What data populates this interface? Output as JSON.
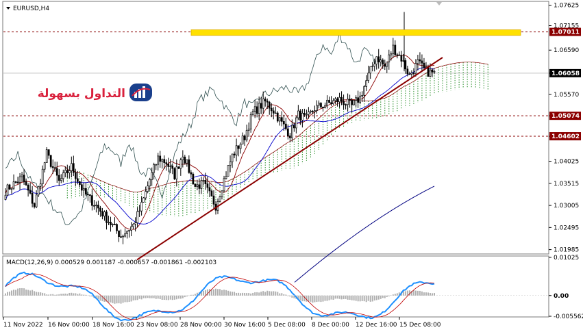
{
  "chart_data": {
    "type": "candlestick",
    "symbol_title": "EURUSD,H4",
    "price_axis": {
      "range": [
        1.019,
        1.077
      ],
      "ticks": [
        "1.07625",
        "1.07155",
        "1.06590",
        "1.06058",
        "1.05570",
        "1.05074",
        "1.04602",
        "1.04025",
        "1.03515",
        "1.03005",
        "1.02495",
        "1.01985"
      ],
      "markers": [
        {
          "label": "1.07011",
          "value": 1.07011,
          "color": "#8b0000"
        },
        {
          "label": "1.06058",
          "value": 1.06058,
          "color": "#000000"
        },
        {
          "label": "1.05074",
          "value": 1.05074,
          "color": "#8b0000"
        },
        {
          "label": "1.04602",
          "value": 1.04602,
          "color": "#8b0000"
        }
      ]
    },
    "time_axis": {
      "labels": [
        "11 Nov 2022",
        "16 Nov 00:00",
        "18 Nov 16:00",
        "23 Nov 08:00",
        "28 Nov 00:00",
        "30 Nov 16:00",
        "5 Dec 08:00",
        "8 Dec 00:00",
        "12 Dec 16:00",
        "15 Dec 08:00"
      ]
    },
    "horizontal_levels": [
      1.07011,
      1.05074,
      1.04602
    ],
    "resistance_zone": [
      1.0693,
      1.0706
    ],
    "trendline": {
      "from": [
        1.0175,
        0
      ],
      "to": [
        1.0642,
        1
      ]
    },
    "macd": {
      "label": "MACD(12,26,9) 0.000529 0.001187 -0.000657 -0.001861 -0.002103",
      "ticks": [
        "0.01025",
        "0.00",
        "-0.005562"
      ],
      "range": [
        -0.00556,
        0.01025
      ]
    },
    "colors": {
      "candles": "#000000",
      "kijun": "#0000cd",
      "tenkan": "#8b0000",
      "chikou": "#2f4f4f",
      "cloud": "#228b22",
      "trendline": "#8b0000",
      "zone": "#ffe000",
      "macd_line": "#1e90ff",
      "signal_line": "#c00000",
      "histogram": "#b0b0b0"
    }
  },
  "watermark": {
    "text": "التداول بسهولة"
  }
}
